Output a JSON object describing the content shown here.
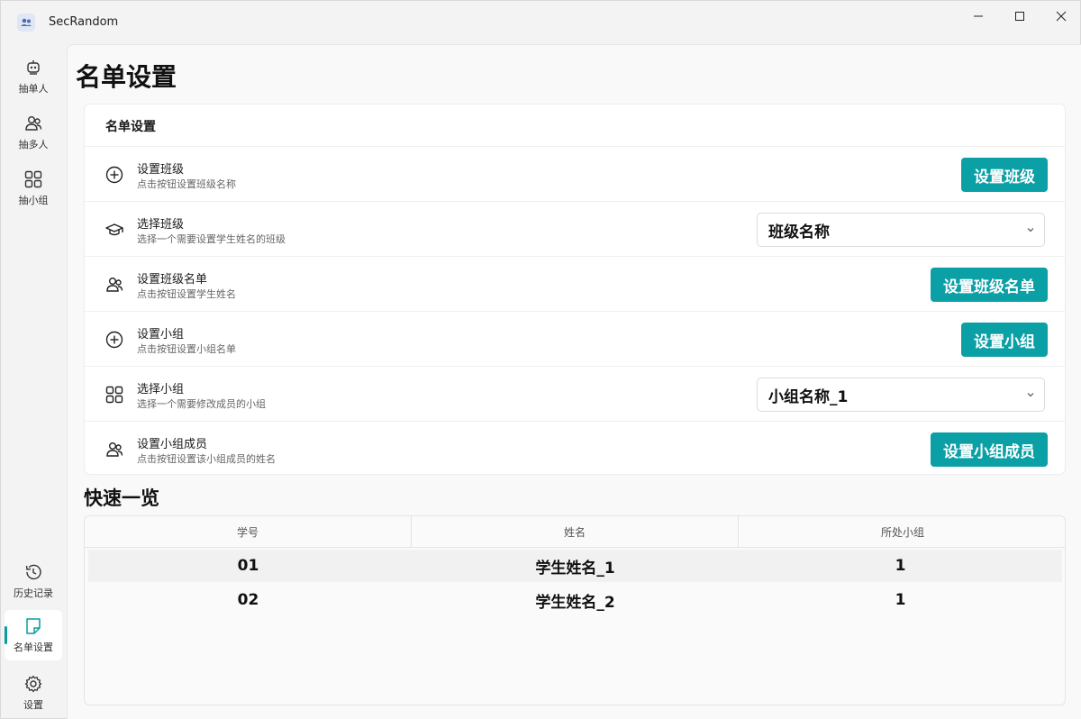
{
  "window": {
    "title": "SecRandom"
  },
  "sidebar": {
    "items": [
      {
        "label": "抽单人",
        "icon": "robot-icon"
      },
      {
        "label": "抽多人",
        "icon": "people-icon"
      },
      {
        "label": "抽小组",
        "icon": "grid-icon"
      },
      {
        "label": "历史记录",
        "icon": "history-icon"
      },
      {
        "label": "名单设置",
        "icon": "note-icon",
        "active": true
      },
      {
        "label": "设置",
        "icon": "gear-icon"
      }
    ]
  },
  "page": {
    "title": "名单设置"
  },
  "settings_card": {
    "title": "名单设置",
    "rows": [
      {
        "title": "设置班级",
        "desc": "点击按钮设置班级名称",
        "button": "设置班级",
        "icon": "add-circle-icon"
      },
      {
        "title": "选择班级",
        "desc": "选择一个需要设置学生姓名的班级",
        "select_value": "班级名称",
        "icon": "graduation-cap-icon"
      },
      {
        "title": "设置班级名单",
        "desc": "点击按钮设置学生姓名",
        "button": "设置班级名单",
        "icon": "people-icon"
      },
      {
        "title": "设置小组",
        "desc": "点击按钮设置小组名单",
        "button": "设置小组",
        "icon": "add-circle-icon"
      },
      {
        "title": "选择小组",
        "desc": "选择一个需要修改成员的小组",
        "select_value": "小组名称_1",
        "icon": "grid-icon"
      },
      {
        "title": "设置小组成员",
        "desc": "点击按钮设置该小组成员的姓名",
        "button": "设置小组成员",
        "icon": "people-icon"
      }
    ]
  },
  "overview": {
    "title": "快速一览",
    "columns": [
      "学号",
      "姓名",
      "所处小组"
    ],
    "rows": [
      [
        "01",
        "学生姓名_1",
        "1"
      ],
      [
        "02",
        "学生姓名_2",
        "1"
      ]
    ]
  },
  "colors": {
    "accent": "#0b9fa6"
  }
}
